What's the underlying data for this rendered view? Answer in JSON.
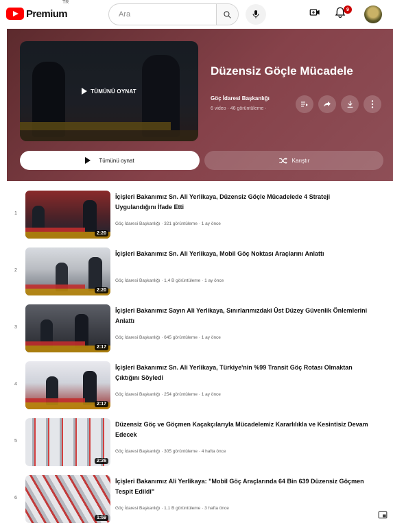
{
  "topbar": {
    "logo_text": "Premium",
    "logo_sup": "TR",
    "search_placeholder": "Ara",
    "notification_count": "9"
  },
  "playlist": {
    "title": "Düzensiz Göçle Mücadele",
    "channel": "Göç İdaresi Başkanlığı",
    "meta": "6 video · 46 görüntüleme ·",
    "thumb_overlay_label": "TÜMÜNÜ OYNAT",
    "play_all_label": "Tümünü oynat",
    "shuffle_label": "Karıştır"
  },
  "videos": [
    {
      "index": "1",
      "title": "İçişleri Bakanımız Sn. Ali Yerlikaya, Düzensiz Göçle Mücadelede 4 Strateji Uygulandığını İfade Etti",
      "meta": "Göç İdaresi Başkanlığı · 321 görüntüleme · 1 ay önce",
      "duration": "2:20"
    },
    {
      "index": "2",
      "title": "İçişleri Bakanımız Sn. Ali Yerlikaya, Mobil Göç Noktası Araçlarını Anlattı",
      "meta": "Göç İdaresi Başkanlığı · 1,4 B görüntüleme · 1 ay önce",
      "duration": "2:20"
    },
    {
      "index": "3",
      "title": "İçişleri Bakanımız Sayın Ali Yerlikaya, Sınırlarımızdaki Üst Düzey Güvenlik Önlemlerini Anlattı",
      "meta": "Göç İdaresi Başkanlığı · 645 görüntüleme · 1 ay önce",
      "duration": "2:17"
    },
    {
      "index": "4",
      "title": "İçişleri Bakanımız Sn. Ali Yerlikaya, Türkiye'nin %99 Transit Göç Rotası Olmaktan Çıktığını Söyledi",
      "meta": "Göç İdaresi Başkanlığı · 254 görüntüleme · 1 ay önce",
      "duration": "2:17"
    },
    {
      "index": "5",
      "title": "Düzensiz Göç ve Göçmen Kaçakçılarıyla Mücadelemiz Kararlılıkla ve Kesintisiz Devam Edecek",
      "meta": "Göç İdaresi Başkanlığı · 305 görüntüleme · 4 hafta önce",
      "duration": "2:26"
    },
    {
      "index": "6",
      "title": "İçişleri Bakanımız Ali Yerlikaya: \"Mobil Göç Araçlarında 64 Bin 639 Düzensiz Göçmen Tespit Edildi\"",
      "meta": "Göç İdaresi Başkanlığı · 1,1 B görüntüleme · 3 hafta önce",
      "duration": "1:59"
    }
  ],
  "colors": {
    "brand_red": "#ff0000",
    "header_bg": "#86424a",
    "notification_badge": "#cc0000"
  }
}
